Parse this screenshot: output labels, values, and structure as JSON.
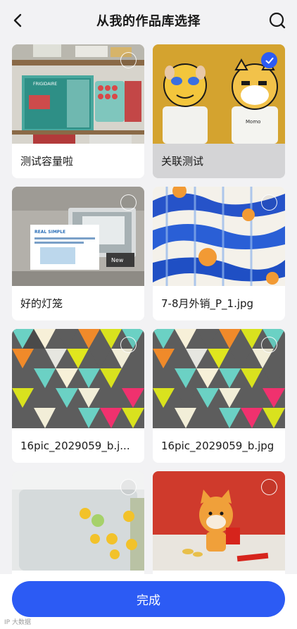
{
  "header": {
    "title": "从我的作品库选择",
    "back_icon": "chevron-left-icon",
    "search_icon": "search-icon"
  },
  "items": [
    {
      "label": "测试容量啦",
      "selected": false
    },
    {
      "label": "关联测试",
      "selected": true
    },
    {
      "label": "好的灯笼",
      "selected": false
    },
    {
      "label": "7-8月外销_P_1.jpg",
      "selected": false
    },
    {
      "label": "16pic_2029059_b.j...",
      "selected": false
    },
    {
      "label": "16pic_2029059_b.jpg",
      "selected": false
    },
    {
      "label": "",
      "selected": false
    },
    {
      "label": "",
      "selected": false
    }
  ],
  "thumb_text": {
    "brand": "FRIGIDAIRE",
    "sign_title": "REAL SIMPLE",
    "sign_body": "The 5 Best Baking Sheets of 2023, According to Our Testing",
    "new_tag": "New",
    "shirt_logo": "Momo"
  },
  "footer": {
    "done_label": "完成",
    "watermark": "IP 大数据"
  },
  "colors": {
    "accent": "#2c5bf4",
    "background": "#f2f2f4",
    "selected_card": "#d4d4d6"
  }
}
